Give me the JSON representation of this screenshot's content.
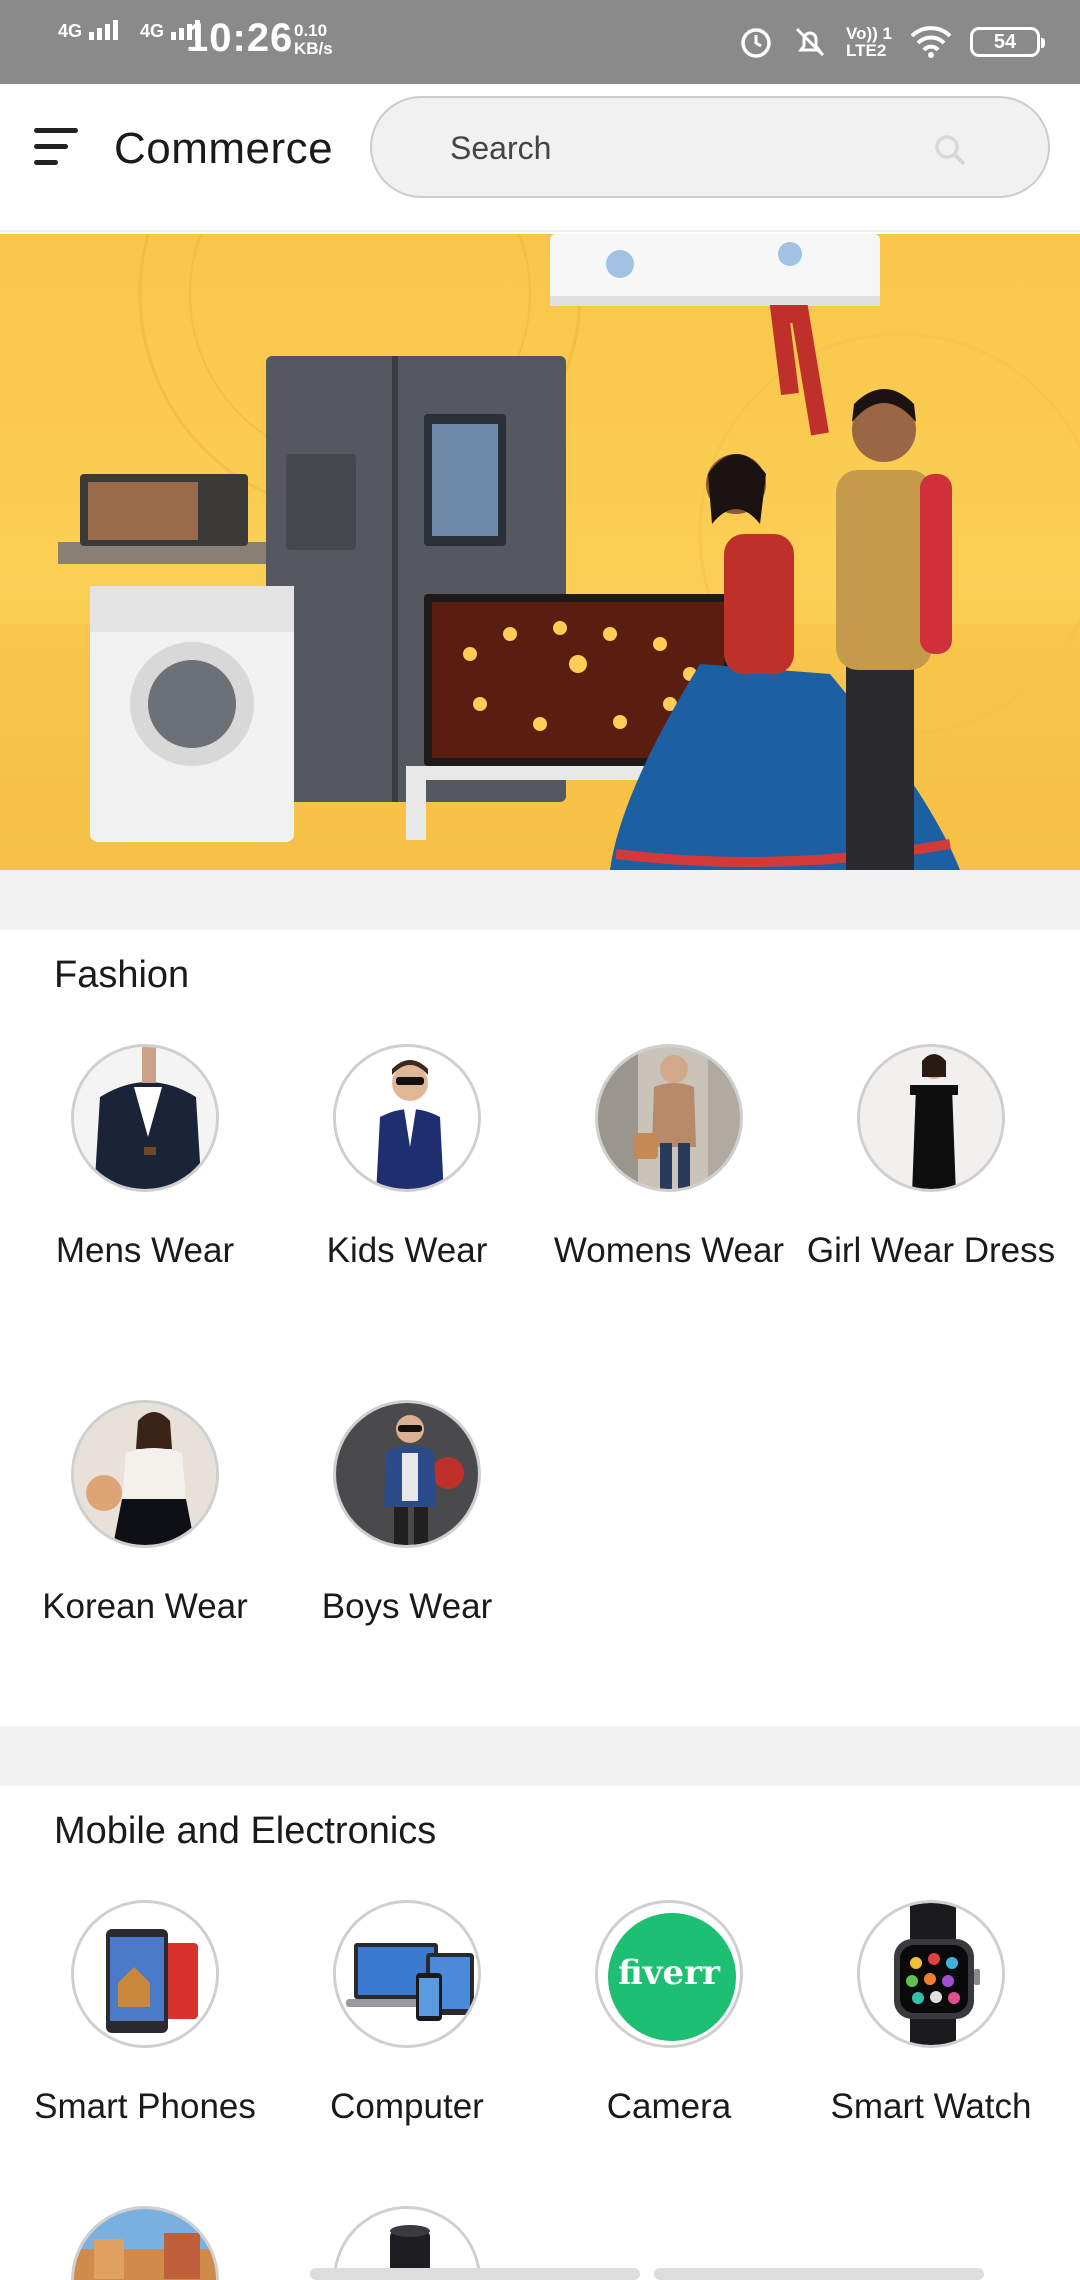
{
  "status_bar": {
    "network": "4G",
    "time": "10:26",
    "speed_value": "0.10",
    "speed_unit": "KB/s",
    "volte": "Vo)) 1",
    "lte": "LTE2",
    "battery": "54"
  },
  "app_bar": {
    "title": "Commerce",
    "search_placeholder": "Search"
  },
  "banner": {
    "slide_count": 7,
    "active_slide": 1
  },
  "sections": [
    {
      "title": "Fashion",
      "items": [
        {
          "label": "Mens Wear",
          "icon": "mens-wear-image"
        },
        {
          "label": "Kids Wear",
          "icon": "kids-wear-image"
        },
        {
          "label": "Womens Wear",
          "icon": "womens-wear-image"
        },
        {
          "label": "Girl Wear Dress",
          "icon": "girl-dress-image"
        },
        {
          "label": "Korean Wear",
          "icon": "korean-wear-image"
        },
        {
          "label": "Boys Wear",
          "icon": "boys-wear-image"
        }
      ]
    },
    {
      "title": "Mobile and Electronics",
      "items": [
        {
          "label": "Smart Phones",
          "icon": "smart-phone-image"
        },
        {
          "label": "Computer",
          "icon": "computer-image"
        },
        {
          "label": "Camera",
          "icon": "fiverr-logo",
          "logo_text": "fiverr"
        },
        {
          "label": "Smart Watch",
          "icon": "smart-watch-image"
        }
      ]
    }
  ],
  "colors": {
    "banner_yellow": "#f9c64a",
    "status_bar": "#8a8a8a",
    "fiverr_green": "#1dbf73"
  }
}
